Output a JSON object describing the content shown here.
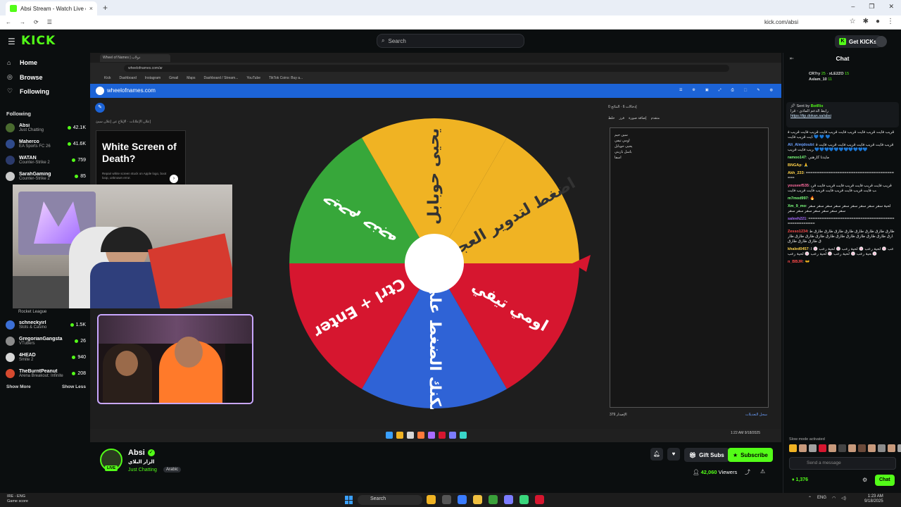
{
  "browser": {
    "tab_title": "Absi Stream - Watch Live o...",
    "tab_close": "×",
    "new_tab": "+",
    "url": "kick.com/absi",
    "window_controls": [
      "–",
      "❐",
      "✕"
    ]
  },
  "header": {
    "logo": "KICK",
    "search_placeholder": "Search",
    "get_kicks_label": "Get KICKs"
  },
  "sidebar": {
    "nav": [
      {
        "label": "Home",
        "icon": "home-icon"
      },
      {
        "label": "Browse",
        "icon": "compass-icon"
      },
      {
        "label": "Following",
        "icon": "heart-icon"
      }
    ],
    "following_title": "Following",
    "channels_top": [
      {
        "name": "Absi",
        "category": "Just Chatting",
        "viewers": "42.1K",
        "color": "#4a6b2f"
      },
      {
        "name": "Maherco",
        "category": "EA Sports FC 26",
        "viewers": "41.6K",
        "color": "#2f4a8b"
      },
      {
        "name": "WATAN",
        "category": "Counter-Strike 2",
        "viewers": "759",
        "color": "#2b3a6b"
      },
      {
        "name": "SarahGaming",
        "category": "Counter-Strike 2",
        "viewers": "85",
        "color": "#c9c9c9"
      }
    ],
    "rocket_league_label": "Rocket League",
    "channels_bottom": [
      {
        "name": "schneckyirl",
        "category": "Slots & Casino",
        "viewers": "1.5K",
        "color": "#3b6fd6"
      },
      {
        "name": "GregorianGangsta",
        "category": "VTubers",
        "viewers": "26",
        "color": "#8b8b8b"
      },
      {
        "name": "4HEAD",
        "category": "Smite 2",
        "viewers": "940",
        "color": "#d6d6d6"
      },
      {
        "name": "TheBurntPeanut",
        "category": "Arena Breakout: Infinite",
        "viewers": "208",
        "color": "#d64a2f"
      }
    ],
    "show_more": "Show More",
    "show_less": "Show Less"
  },
  "stream_screen": {
    "inner_url": "wheelofnames.com/ar",
    "inner_tab": "Wheel of Names | دولاب",
    "bookmarks": [
      "Kick",
      "Dashboard",
      "Instagram",
      "Gmail",
      "Maps",
      "Dashboard / Stream...",
      "YouTube",
      "TikTok Coins: Buy a..."
    ],
    "site_title": "wheelofnames.com",
    "ad_labels": "إعلان الإعلانات · الإبلاغ عن إعلان سيئ",
    "ad_title": "White Screen of Death?",
    "ad_sub": "Repair white screen stuck on Apple logo, boot loop, unknown error.",
    "panel_tabs": "إدخالات 6 · النتائج 0",
    "panel_tools": [
      "خلط",
      "فرز",
      "إضافة صورة",
      "متقدم"
    ],
    "entries": [
      "سين حيم",
      "اومي تيفي",
      "يحيى حوبابل",
      "باسل بازيني",
      "اسفا"
    ],
    "entries_count": "379 الإصدار",
    "entries_link": "سجل التعديلات",
    "wheel_segments": [
      {
        "label": "اضغط لتدوير العجلة",
        "color": "#f0b323"
      },
      {
        "label": "اومي تيفي",
        "color": "#d6162f"
      },
      {
        "label": "أو يمكنك الضغط على زر",
        "color": "#2f63d6"
      },
      {
        "label": "Ctrl + Enter",
        "color": "#d6162f"
      },
      {
        "label": "حيحم حنجه",
        "color": "#37a73a"
      },
      {
        "label": "يحيى حوبابل",
        "color": "#f0b323"
      }
    ],
    "inner_clock": "1:22 AM 9/18/2025"
  },
  "stream_info": {
    "streamer": "Absi",
    "live_label": "LIVE",
    "title": "الزار البلاي",
    "category": "Just Chatting",
    "language": "Arabic",
    "gift_subs": "Gift Subs",
    "subscribe": "Subscribe",
    "viewers": "42,060",
    "viewers_label": "Viewers"
  },
  "chat": {
    "title": "Chat",
    "leaders": [
      {
        "name": "CR7ry",
        "value": "25"
      },
      {
        "name": "xLE2ZO",
        "value": "15"
      },
      {
        "name": "Aslam_10",
        "value": "11"
      }
    ],
    "pinned_by": "Sent by",
    "pinned_user": "BotRix",
    "pinned_text": "رابط الدعم المادي - قرا",
    "pinned_link": "https://tip.dokan.sa/absi",
    "messages": [
      {
        "user": "",
        "color": "#e6e6e6",
        "text": "قريب فايت قريب فايت قريب فايت قريب فايت قريب فايت قريب فايت قريب فايت 💙 💙 💙"
      },
      {
        "user": "Ali_Almjdoubi",
        "color": "#6ca0ff",
        "text": "قريب فايت قريب فايت قريب فايت قريب فايت قريب فايت قريب 💙💙💙💙💙💙💙💙💙💙💙"
      },
      {
        "user": "ramoo147",
        "color": "#7cff7c",
        "text": "مايدنا كارهني"
      },
      {
        "user": "BNGAp",
        "color": "#ffd24a",
        "text": "🙏"
      },
      {
        "user": "Akh_233",
        "color": "#ffd24a",
        "text": "=========================================="
      },
      {
        "user": "youseef535",
        "color": "#ff6ca0",
        "text": "قريب فايت قريب فايت قريب فايت قريب فايت قريب فايت قريب فايت قريب فايت قريب فايت قريب فايت"
      },
      {
        "user": "m7mod997",
        "color": "#7cff7c",
        "text": "🔥"
      },
      {
        "user": "Xm_9_mo",
        "color": "#7cff7c",
        "text": "لحية سقر سقر سقر سقر سقر سقر سقر سقر سقر سقر سقر سقر سقر سقر سقر سقر"
      },
      {
        "user": "saleeh221",
        "color": "#a96cff",
        "text": "=================================================="
      },
      {
        "user": "Zesso1234",
        "color": "#ff4a4a",
        "text": "طارق طارق طارق طارق طارق طارق طارق طارق طارق طارق طارق طارق طارق طارق طارق طارق طارق طارق طارق طارق طارق طارق"
      },
      {
        "user": "khaled0457",
        "color": "#ffd24a",
        "text": "عب 🍥 لحية رعب 🍥 لحية رعب 🍥 لحية رعب 🍥 لحية رعب 🍥 لحية رعب 🍥 لحية رعب 🍥 لحية رعب 🍥"
      },
      {
        "user": "n_BBJR",
        "color": "#ff4a4a",
        "text": "👐"
      }
    ],
    "slow_mode": "Slow mode activated",
    "input_placeholder": "Send a message",
    "kicks_count": "1,376",
    "send_label": "Chat"
  },
  "os_taskbar": {
    "left_line1": "IRE - ENG",
    "left_line2": "Game score",
    "search": "Search",
    "lang": "ENG",
    "time": "1:23 AM",
    "date": "9/18/2025"
  }
}
